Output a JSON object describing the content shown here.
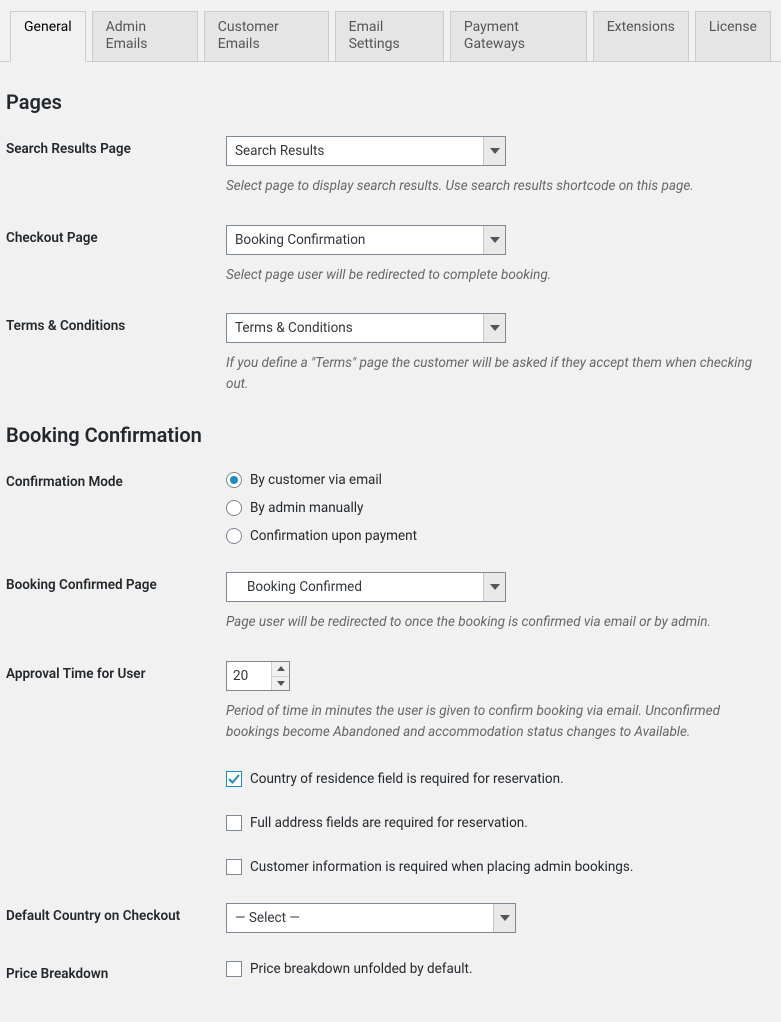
{
  "tabs": [
    {
      "label": "General",
      "active": true
    },
    {
      "label": "Admin Emails",
      "active": false
    },
    {
      "label": "Customer Emails",
      "active": false
    },
    {
      "label": "Email Settings",
      "active": false
    },
    {
      "label": "Payment Gateways",
      "active": false
    },
    {
      "label": "Extensions",
      "active": false
    },
    {
      "label": "License",
      "active": false
    }
  ],
  "sections": {
    "pages": {
      "title": "Pages",
      "search_results": {
        "label": "Search Results Page",
        "value": "Search Results",
        "desc": "Select page to display search results. Use search results shortcode on this page."
      },
      "checkout": {
        "label": "Checkout Page",
        "value": "Booking Confirmation",
        "desc": "Select page user will be redirected to complete booking."
      },
      "terms": {
        "label": "Terms & Conditions",
        "value": "Terms & Conditions",
        "desc": "If you define a \"Terms\" page the customer will be asked if they accept them when checking out."
      }
    },
    "booking": {
      "title": "Booking Confirmation",
      "confirmation_mode": {
        "label": "Confirmation Mode",
        "options": [
          {
            "label": "By customer via email",
            "checked": true
          },
          {
            "label": "By admin manually",
            "checked": false
          },
          {
            "label": "Confirmation upon payment",
            "checked": false
          }
        ]
      },
      "confirmed_page": {
        "label": "Booking Confirmed Page",
        "value": "Booking Confirmed",
        "desc": "Page user will be redirected to once the booking is confirmed via email or by admin."
      },
      "approval_time": {
        "label": "Approval Time for User",
        "value": "20",
        "desc": "Period of time in minutes the user is given to confirm booking via email. Unconfirmed bookings become Abandoned and accommodation status changes to Available."
      },
      "checkboxes": {
        "country_required": {
          "label": "Country of residence field is required for reservation.",
          "checked": true
        },
        "address_required": {
          "label": "Full address fields are required for reservation.",
          "checked": false
        },
        "admin_customer_info": {
          "label": "Customer information is required when placing admin bookings.",
          "checked": false
        }
      },
      "default_country": {
        "label": "Default Country on Checkout",
        "value": "— Select —"
      },
      "price_breakdown": {
        "label": "Price Breakdown",
        "checkbox_label": "Price breakdown unfolded by default.",
        "checked": false
      }
    }
  }
}
